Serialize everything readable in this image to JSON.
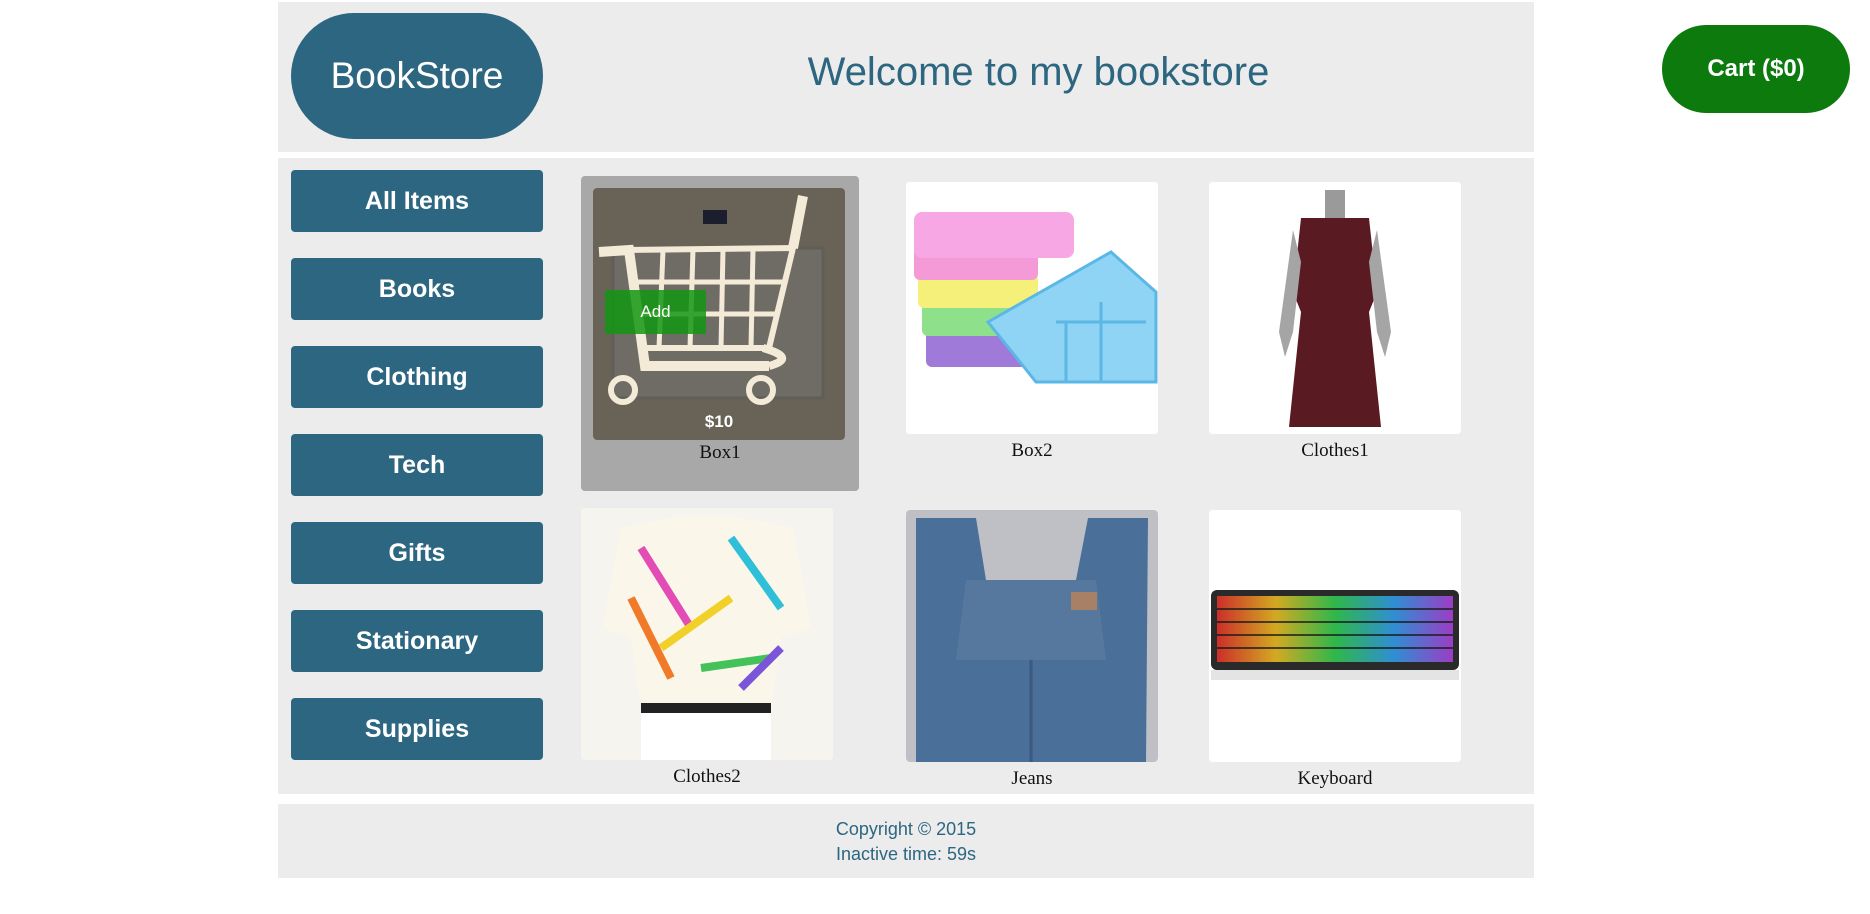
{
  "header": {
    "logo": "BookStore",
    "welcome": "Welcome to my bookstore"
  },
  "cart": {
    "label": "Cart ($0)"
  },
  "categories": [
    {
      "label": "All Items"
    },
    {
      "label": "Books"
    },
    {
      "label": "Clothing"
    },
    {
      "label": "Tech"
    },
    {
      "label": "Gifts"
    },
    {
      "label": "Stationary"
    },
    {
      "label": "Supplies"
    }
  ],
  "products": [
    {
      "name": "Box1",
      "price": "$10",
      "add_label": "Add"
    },
    {
      "name": "Box2"
    },
    {
      "name": "Clothes1"
    },
    {
      "name": "Clothes2"
    },
    {
      "name": "Jeans"
    },
    {
      "name": "Keyboard"
    }
  ],
  "footer": {
    "copyright": "Copyright © 2015",
    "inactive": "Inactive time: 59s"
  },
  "colors": {
    "brand": "#2d6680",
    "cart": "#0c7a0c",
    "panel": "#ececec"
  }
}
